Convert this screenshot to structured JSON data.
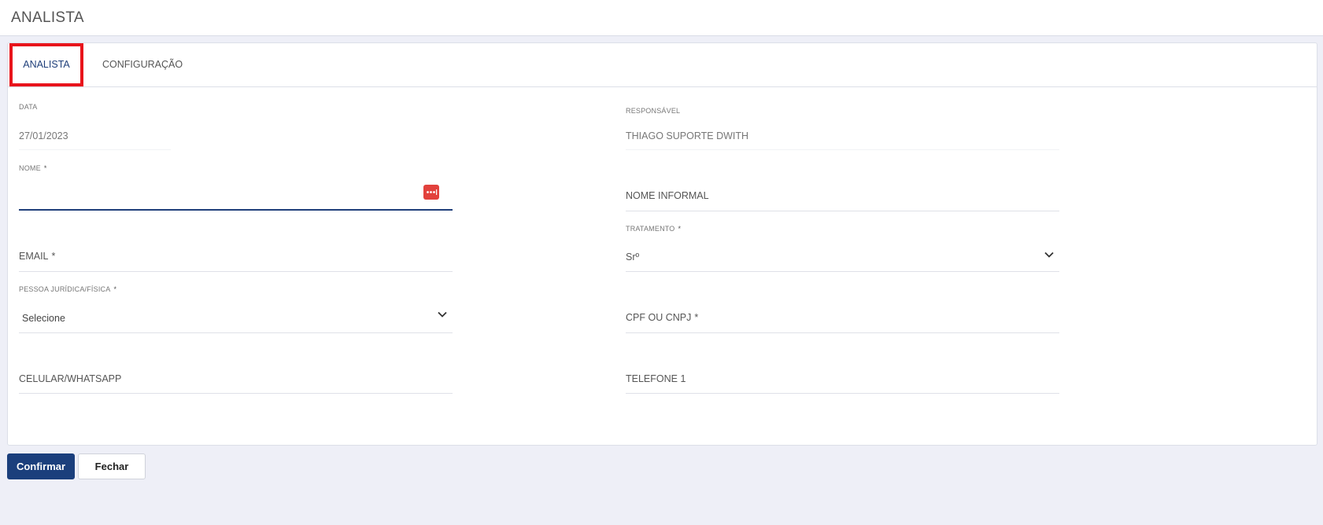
{
  "header": {
    "title": "ANALISTA"
  },
  "tabs": [
    {
      "label": "ANALISTA",
      "active": true
    },
    {
      "label": "CONFIGURAÇÃO",
      "active": false
    }
  ],
  "form": {
    "data": {
      "label": "DATA",
      "value": "27/01/2023"
    },
    "responsavel": {
      "label": "RESPONSÁVEL",
      "value": "THIAGO SUPORTE DWITH"
    },
    "nome": {
      "label": "NOME",
      "required_mark": "*",
      "value": ""
    },
    "nome_informal": {
      "label": "NOME INFORMAL"
    },
    "email": {
      "label": "EMAIL",
      "required_mark": "*"
    },
    "tratamento": {
      "label": "TRATAMENTO",
      "required_mark": "*",
      "value": "Srº"
    },
    "pessoa": {
      "label": "PESSOA JURÍDICA/FÍSICA",
      "required_mark": "*",
      "value": "Selecione"
    },
    "cpf_cnpj": {
      "label": "CPF OU CNPJ",
      "required_mark": "*"
    },
    "celular": {
      "label": "CELULAR/WHATSAPP"
    },
    "telefone1": {
      "label": "TELEFONE 1"
    }
  },
  "buttons": {
    "confirm": "Confirmar",
    "close": "Fechar"
  },
  "icons": {
    "password_manager": "password-dots-icon",
    "chevron": "chevron-down-icon"
  },
  "colors": {
    "accent": "#1b3f7c",
    "highlight": "#e8141b",
    "password_icon": "#e2413c",
    "background": "#eeeff7"
  }
}
